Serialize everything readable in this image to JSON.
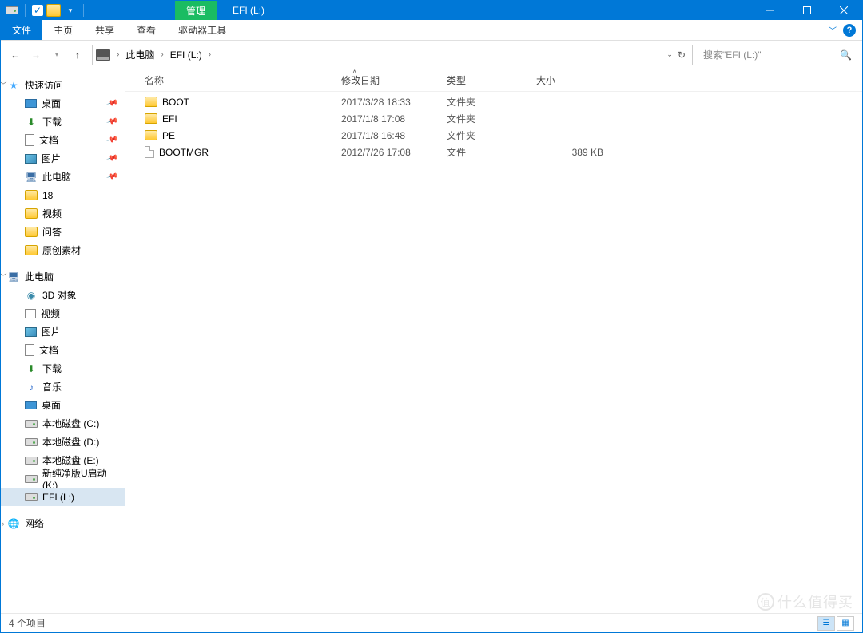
{
  "titlebar": {
    "context_tab": "管理",
    "title": "EFI (L:)"
  },
  "ribbon": {
    "file": "文件",
    "tabs": [
      "主页",
      "共享",
      "查看",
      "驱动器工具"
    ]
  },
  "nav": {
    "breadcrumb": [
      "此电脑",
      "EFI (L:)"
    ],
    "search_placeholder": "搜索\"EFI (L:)\""
  },
  "sidebar": {
    "quick_access": {
      "label": "快速访问",
      "items": [
        {
          "label": "桌面",
          "icon": "desktop",
          "pinned": true
        },
        {
          "label": "下载",
          "icon": "down",
          "pinned": true
        },
        {
          "label": "文档",
          "icon": "doc",
          "pinned": true
        },
        {
          "label": "图片",
          "icon": "pic",
          "pinned": true
        },
        {
          "label": "此电脑",
          "icon": "pc",
          "pinned": true
        },
        {
          "label": "18",
          "icon": "folder",
          "pinned": false
        },
        {
          "label": "视频",
          "icon": "folder",
          "pinned": false
        },
        {
          "label": "问答",
          "icon": "folder",
          "pinned": false
        },
        {
          "label": "原创素材",
          "icon": "folder",
          "pinned": false
        }
      ]
    },
    "this_pc": {
      "label": "此电脑",
      "items": [
        {
          "label": "3D 对象",
          "icon": "obj3d"
        },
        {
          "label": "视频",
          "icon": "vid"
        },
        {
          "label": "图片",
          "icon": "pic"
        },
        {
          "label": "文档",
          "icon": "doc"
        },
        {
          "label": "下载",
          "icon": "down"
        },
        {
          "label": "音乐",
          "icon": "music"
        },
        {
          "label": "桌面",
          "icon": "desktop"
        },
        {
          "label": "本地磁盘 (C:)",
          "icon": "drive"
        },
        {
          "label": "本地磁盘 (D:)",
          "icon": "drive"
        },
        {
          "label": "本地磁盘 (E:)",
          "icon": "drive"
        },
        {
          "label": "新纯净版U启动 (K:)",
          "icon": "drive"
        },
        {
          "label": "EFI (L:)",
          "icon": "drive",
          "active": true
        }
      ]
    },
    "network": {
      "label": "网络"
    }
  },
  "columns": {
    "name": "名称",
    "date": "修改日期",
    "type": "类型",
    "size": "大小"
  },
  "files": [
    {
      "name": "BOOT",
      "date": "2017/3/28 18:33",
      "type": "文件夹",
      "size": "",
      "icon": "folder"
    },
    {
      "name": "EFI",
      "date": "2017/1/8 17:08",
      "type": "文件夹",
      "size": "",
      "icon": "folder"
    },
    {
      "name": "PE",
      "date": "2017/1/8 16:48",
      "type": "文件夹",
      "size": "",
      "icon": "folder"
    },
    {
      "name": "BOOTMGR",
      "date": "2012/7/26 17:08",
      "type": "文件",
      "size": "389 KB",
      "icon": "file"
    }
  ],
  "status": {
    "count": "4 个项目"
  },
  "watermark": "什么值得买"
}
